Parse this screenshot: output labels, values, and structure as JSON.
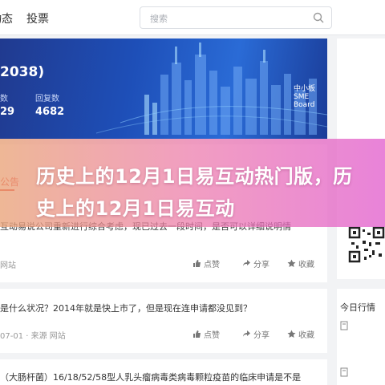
{
  "nav": {
    "item1": "动态",
    "item2": "投票"
  },
  "search": {
    "placeholder": "搜索"
  },
  "banner": {
    "code": "2038)",
    "stat1_label": "数",
    "stat1_value": "29",
    "stat2_label": "回复数",
    "stat2_value": "4682",
    "board": "中小板 SME Board"
  },
  "tabs": {
    "active": "公告"
  },
  "overlay": {
    "title": "历史上的12月1日易互动热门版，历史上的12月1日易互动"
  },
  "feed": [
    {
      "text": "互动易说公司重新进行综合考虑，现已过去一段时间，是否可以详细说明情",
      "meta": "网站",
      "like": "点赞",
      "share": "分享",
      "fav": "收藏"
    },
    {
      "text": "是什么状况？2014年就是快上市了，但是现在连申请都没见到？",
      "meta": "07-01 · 来源 网站",
      "like": "点赞",
      "share": "分享",
      "fav": "收藏"
    },
    {
      "text": "（大肠杆菌）16/18/52/58型人乳头瘤病毒类病毒颗粒疫苗的临床申请是不是"
    }
  ],
  "right": {
    "today": "今日行情"
  },
  "colors": {
    "accent": "#e8382f",
    "banner": "#1e4fb8"
  }
}
